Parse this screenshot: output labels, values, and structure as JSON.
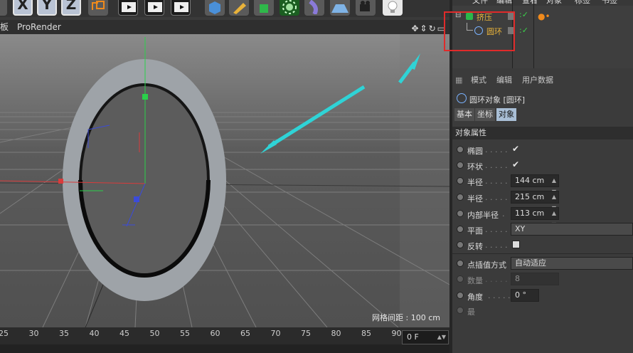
{
  "toolbar": {
    "axis_x": "X",
    "axis_y": "Y",
    "axis_z": "Z"
  },
  "viewport": {
    "menu_left": "板",
    "menu_renderer": "ProRender",
    "grid_info": "网格间距 : 100 cm"
  },
  "timeline": {
    "ticks": [
      "25",
      "30",
      "35",
      "40",
      "45",
      "50",
      "55",
      "60",
      "65",
      "70",
      "75",
      "80",
      "85",
      "90"
    ],
    "frame_value": "0 F"
  },
  "object_manager": {
    "menu_items": [
      "文件",
      "编辑",
      "查看",
      "对象",
      "标签",
      "书签"
    ],
    "parent_label": "挤压",
    "child_label": "圆环"
  },
  "attribute_manager": {
    "menu": [
      "模式",
      "编辑",
      "用户数据"
    ],
    "object_title": "圆环对象 [圆环]",
    "tabs": [
      "基本",
      "坐标",
      "对象"
    ],
    "section_title": "对象属性",
    "ellipse_label": "椭圆",
    "ring_label": "环状",
    "radius1_label": "半径",
    "radius1_value": "144 cm",
    "radius2_label": "半径",
    "radius2_value": "215 cm",
    "inner_radius_label": "内部半径",
    "inner_radius_value": "113 cm",
    "plane_label": "平面",
    "plane_value": "XY",
    "reverse_label": "反转",
    "interp_label": "点插值方式",
    "interp_value": "自动适应",
    "count_label": "数量",
    "count_value": "8",
    "angle_label": "角度",
    "angle_value": "0 °",
    "last_label": "最"
  },
  "colors": {
    "highlight_box": "#e02a2a",
    "annotation_arrow": "#2fd3d6",
    "object_label": "#e8b23a"
  }
}
